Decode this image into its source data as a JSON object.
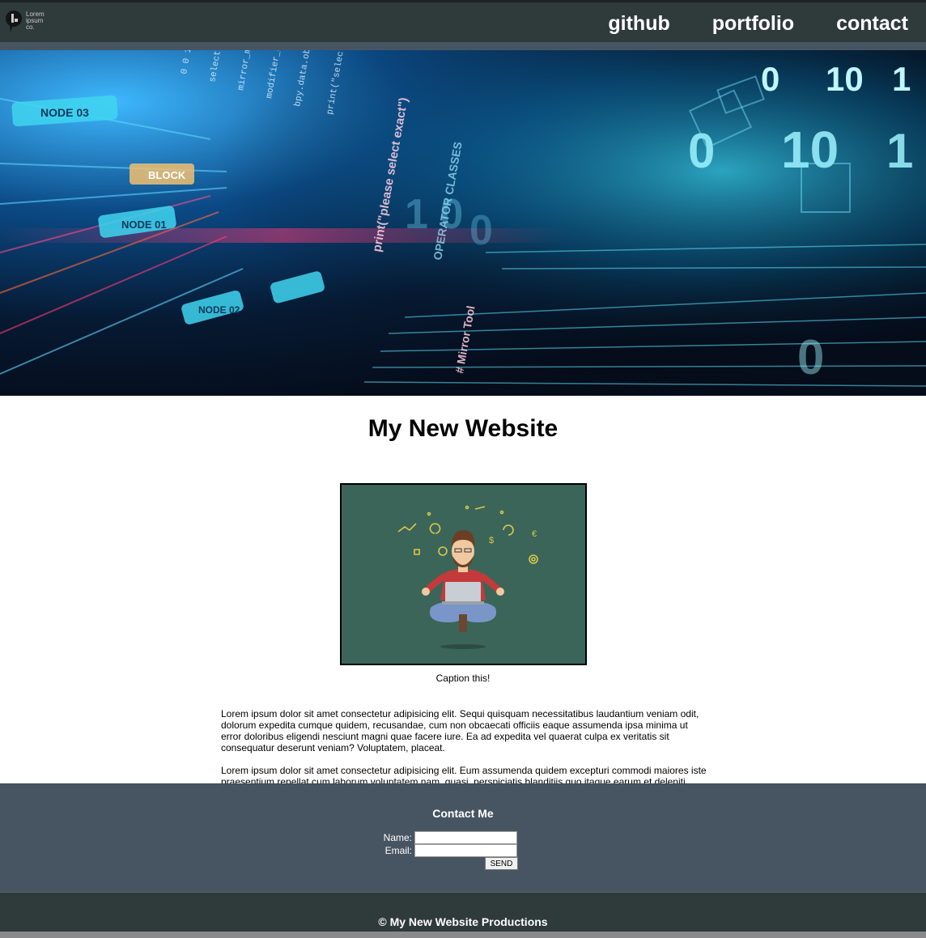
{
  "nav": {
    "logo_text": [
      "Lorem",
      "ipsum",
      "co."
    ],
    "links": [
      "github",
      "portfolio",
      "contact"
    ]
  },
  "hero": {
    "labels": [
      "NODE 03",
      "BLOCK",
      "NODE 01",
      "NODE 02",
      "print(\"please select exact\")",
      "OPERATOR CLASSES",
      "# Mirror Tool",
      "0",
      "10",
      "1"
    ]
  },
  "main": {
    "title": "My New Website",
    "caption": "Caption this!",
    "paragraphs": [
      "Lorem ipsum dolor sit amet consectetur adipisicing elit. Sequi quisquam necessitatibus laudantium veniam odit, dolorum expedita cumque quidem, recusandae, cum non obcaecati officiis eaque assumenda ipsa minima ut error doloribus eligendi nesciunt magni quae facere iure. Ea ad expedita vel quaerat culpa ex veritatis sit consequatur deserunt veniam? Voluptatem, placeat.",
      "Lorem ipsum dolor sit amet consectetur adipisicing elit. Eum assumenda quidem excepturi commodi maiores iste praesentium repellat cum laborum voluptatem nam, quasi, perspiciatis blanditiis quo itaque earum et deleniti. Nulla!"
    ]
  },
  "contact": {
    "title": "Contact Me",
    "name_label": "Name:",
    "email_label": "Email:",
    "name_value": "",
    "email_value": "",
    "send_label": "SEND"
  },
  "footer": {
    "text": "© My New Website Productions"
  },
  "colors": {
    "nav_bg": "#2f3a3b",
    "contact_bg": "#475562",
    "figure_bg": "#3b6559"
  }
}
